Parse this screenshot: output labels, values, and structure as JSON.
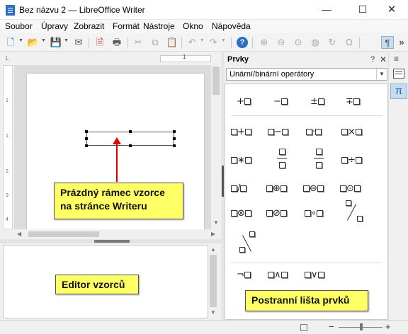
{
  "window": {
    "title": "Bez názvu 2 — LibreOffice Writer",
    "minimize": "—",
    "maximize": "☐",
    "close": "✕"
  },
  "menu": [
    "Soubor",
    "Úpravy",
    "Zobrazit",
    "Formát",
    "Nástroje",
    "Okno",
    "Nápověda"
  ],
  "toolbar": {
    "icons": [
      "new-document",
      "open-folder",
      "save",
      "email",
      "export-pdf",
      "print",
      "cut",
      "copy",
      "paste",
      "undo",
      "redo",
      "help",
      "zoom-in",
      "zoom-out",
      "zoom-100",
      "zoom-fit",
      "redraw",
      "symbol-omega",
      "formatting-marks"
    ],
    "overflow": "»"
  },
  "ruler": {
    "tick": "1",
    "corner": "L"
  },
  "vruler": [
    "1",
    "1",
    "2",
    "3",
    "4"
  ],
  "elements_panel": {
    "title": "Prvky",
    "help": "?",
    "close": "✕",
    "category": "Unární/binární operátory",
    "unary_ops": [
      "+",
      "−",
      "±",
      "∓"
    ],
    "binary_ops_row1": [
      "+",
      "−",
      "·",
      "×"
    ],
    "binary_ops_row2_mul": "∗",
    "binary_ops_row2_div": "÷",
    "binary_ops_row3": [
      "/",
      "⊕",
      "⊖",
      "⊙"
    ],
    "binary_ops_row4": [
      "⊗",
      "⊘",
      "∘"
    ],
    "logic_ops": [
      "¬",
      "∧",
      "∨"
    ]
  },
  "right_tabbar": {
    "menu": "≡",
    "pi": "π"
  },
  "status": {
    "minus": "−",
    "plus": "+"
  },
  "callouts": {
    "formula_frame_line1": "Prázdný rámec vzorce",
    "formula_frame_line2": "na stránce Writeru",
    "formula_editor": "Editor vzorců",
    "elements_sidebar": "Postranní lišta prvků"
  },
  "colors": {
    "accent": "#2a6ec6",
    "callout_bg": "#ffff66",
    "arrow": "#e00000"
  }
}
